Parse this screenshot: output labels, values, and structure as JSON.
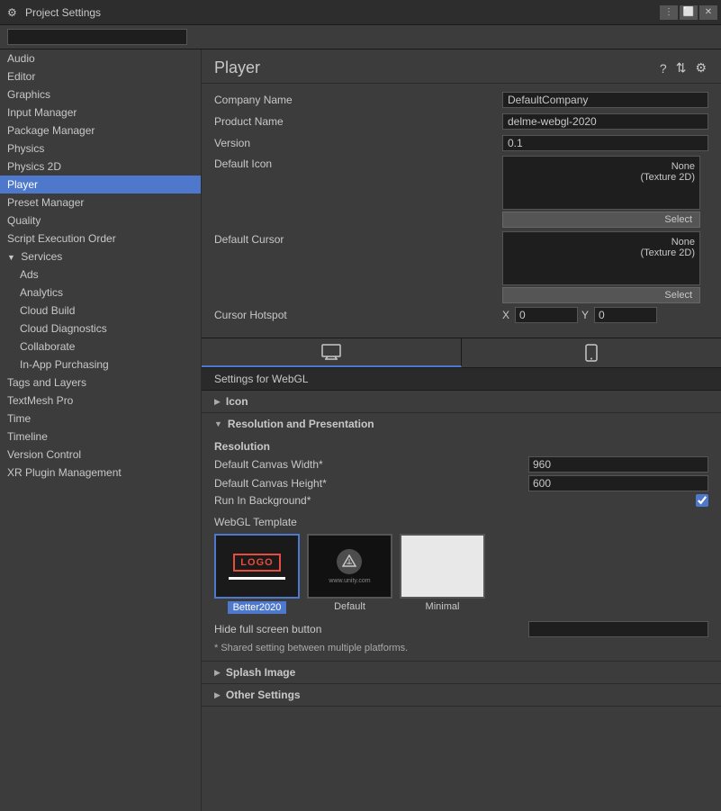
{
  "titleBar": {
    "title": "Project Settings",
    "icon": "⚙"
  },
  "search": {
    "placeholder": ""
  },
  "sidebar": {
    "items": [
      {
        "id": "audio",
        "label": "Audio",
        "level": 0,
        "active": false
      },
      {
        "id": "editor",
        "label": "Editor",
        "level": 0,
        "active": false
      },
      {
        "id": "graphics",
        "label": "Graphics",
        "level": 0,
        "active": false
      },
      {
        "id": "input-manager",
        "label": "Input Manager",
        "level": 0,
        "active": false
      },
      {
        "id": "package-manager",
        "label": "Package Manager",
        "level": 0,
        "active": false
      },
      {
        "id": "physics",
        "label": "Physics",
        "level": 0,
        "active": false
      },
      {
        "id": "physics-2d",
        "label": "Physics 2D",
        "level": 0,
        "active": false
      },
      {
        "id": "player",
        "label": "Player",
        "level": 0,
        "active": true
      },
      {
        "id": "preset-manager",
        "label": "Preset Manager",
        "level": 0,
        "active": false
      },
      {
        "id": "quality",
        "label": "Quality",
        "level": 0,
        "active": false
      },
      {
        "id": "script-execution-order",
        "label": "Script Execution Order",
        "level": 0,
        "active": false
      },
      {
        "id": "services",
        "label": "Services",
        "level": 0,
        "active": false,
        "expandable": true
      },
      {
        "id": "ads",
        "label": "Ads",
        "level": 1,
        "active": false
      },
      {
        "id": "analytics",
        "label": "Analytics",
        "level": 1,
        "active": false
      },
      {
        "id": "cloud-build",
        "label": "Cloud Build",
        "level": 1,
        "active": false
      },
      {
        "id": "cloud-diagnostics",
        "label": "Cloud Diagnostics",
        "level": 1,
        "active": false
      },
      {
        "id": "collaborate",
        "label": "Collaborate",
        "level": 1,
        "active": false
      },
      {
        "id": "in-app-purchasing",
        "label": "In-App Purchasing",
        "level": 1,
        "active": false
      },
      {
        "id": "tags-and-layers",
        "label": "Tags and Layers",
        "level": 0,
        "active": false
      },
      {
        "id": "textmesh-pro",
        "label": "TextMesh Pro",
        "level": 0,
        "active": false
      },
      {
        "id": "time",
        "label": "Time",
        "level": 0,
        "active": false
      },
      {
        "id": "timeline",
        "label": "Timeline",
        "level": 0,
        "active": false
      },
      {
        "id": "version-control",
        "label": "Version Control",
        "level": 0,
        "active": false
      },
      {
        "id": "xr-plugin-management",
        "label": "XR Plugin Management",
        "level": 0,
        "active": false
      }
    ]
  },
  "content": {
    "title": "Player",
    "fields": {
      "companyName": {
        "label": "Company Name",
        "value": "DefaultCompany"
      },
      "productName": {
        "label": "Product Name",
        "value": "delme-webgl-2020"
      },
      "version": {
        "label": "Version",
        "value": "0.1"
      },
      "defaultIcon": {
        "label": "Default Icon",
        "noneLabel": "None",
        "noneType": "(Texture 2D)",
        "selectBtn": "Select"
      },
      "defaultCursor": {
        "label": "Default Cursor",
        "noneLabel": "None",
        "noneType": "(Texture 2D)",
        "selectBtn": "Select"
      },
      "cursorHotspot": {
        "label": "Cursor Hotspot",
        "xLabel": "X",
        "xValue": "0",
        "yLabel": "Y",
        "yValue": "0"
      }
    },
    "settingsFor": "Settings for WebGL",
    "sections": {
      "icon": {
        "label": "Icon",
        "expanded": false
      },
      "resolutionAndPresentation": {
        "label": "Resolution and Presentation",
        "expanded": true,
        "resolution": {
          "title": "Resolution",
          "defaultCanvasWidth": {
            "label": "Default Canvas Width*",
            "value": "960"
          },
          "defaultCanvasHeight": {
            "label": "Default Canvas Height*",
            "value": "600"
          },
          "runInBackground": {
            "label": "Run In Background*",
            "checked": true
          }
        },
        "webglTemplate": {
          "label": "WebGL Template",
          "options": [
            {
              "id": "better2020",
              "label": "Better2020",
              "selected": true
            },
            {
              "id": "default",
              "label": "Default",
              "selected": false
            },
            {
              "id": "minimal",
              "label": "Minimal",
              "selected": false
            }
          ]
        },
        "hideFullScreenButton": {
          "label": "Hide full screen button",
          "value": ""
        },
        "sharedNote": "* Shared setting between multiple platforms."
      },
      "splashImage": {
        "label": "Splash Image",
        "expanded": false
      },
      "otherSettings": {
        "label": "Other Settings",
        "expanded": false
      }
    }
  }
}
